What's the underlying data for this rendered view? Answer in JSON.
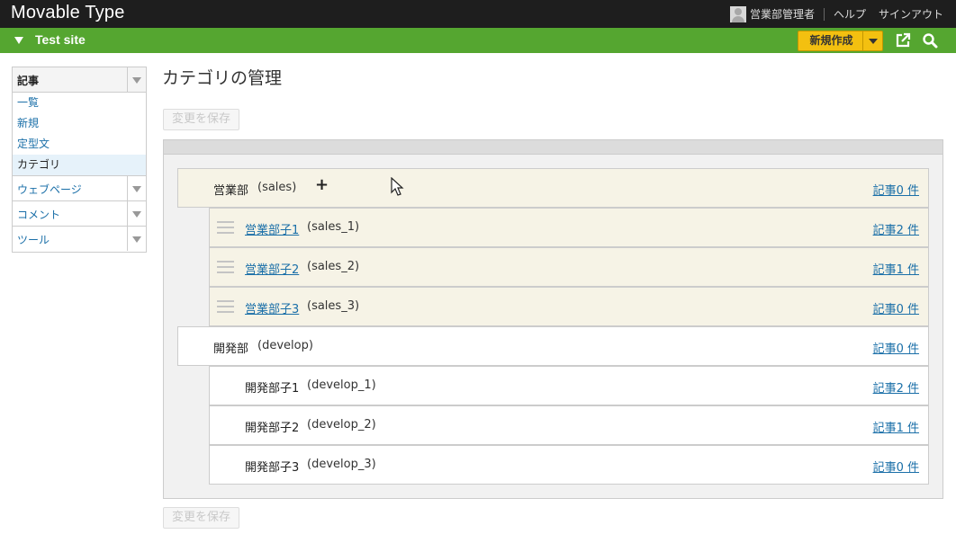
{
  "app": {
    "title": "Movable Type"
  },
  "user": {
    "name": "営業部管理者",
    "help": "ヘルプ",
    "signout": "サインアウト"
  },
  "site": {
    "name": "Test site",
    "new_label": "新規作成"
  },
  "sidebar": {
    "sections": [
      {
        "label": "記事",
        "items": [
          {
            "label": "一覧"
          },
          {
            "label": "新規"
          },
          {
            "label": "定型文"
          },
          {
            "label": "カテゴリ"
          }
        ]
      },
      {
        "label": "ウェブページ"
      },
      {
        "label": "コメント"
      },
      {
        "label": "ツール"
      }
    ]
  },
  "main": {
    "title": "カテゴリの管理",
    "save_top": "変更を保存",
    "save_bottom": "変更を保存",
    "categories": [
      {
        "name": "営業部",
        "basename": "(sales)",
        "count": "記事0 件"
      },
      {
        "name": "営業部子1",
        "basename": "(sales_1)",
        "count": "記事2 件"
      },
      {
        "name": "営業部子2",
        "basename": "(sales_2)",
        "count": "記事1 件"
      },
      {
        "name": "営業部子3",
        "basename": "(sales_3)",
        "count": "記事0 件"
      },
      {
        "name": "開発部",
        "basename": "(develop)",
        "count": "記事0 件"
      },
      {
        "name": "開発部子1",
        "basename": "(develop_1)",
        "count": "記事2 件"
      },
      {
        "name": "開発部子2",
        "basename": "(develop_2)",
        "count": "記事1 件"
      },
      {
        "name": "開発部子3",
        "basename": "(develop_3)",
        "count": "記事0 件"
      }
    ]
  },
  "colors": {
    "topbar": "#1e1e1e",
    "sitebar": "#55a630",
    "accent_button": "#f3c010",
    "link": "#1a6fa8",
    "row_highlight": "#f6f3e6"
  },
  "icons": {
    "view_site": "external-link-icon",
    "search": "search-icon",
    "drag": "drag-handle-icon",
    "add": "plus-icon"
  }
}
